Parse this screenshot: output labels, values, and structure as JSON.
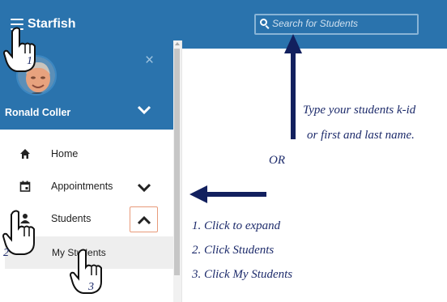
{
  "topbar": {
    "brand": "Starfish",
    "search_placeholder": "Search for Students"
  },
  "profile": {
    "name": "Ronald Coller",
    "close_glyph": "×"
  },
  "nav": {
    "items": [
      {
        "label": "Home",
        "icon": "home-icon"
      },
      {
        "label": "Appointments",
        "icon": "calendar-icon"
      },
      {
        "label": "Students",
        "icon": "students-icon"
      }
    ],
    "sub_items": [
      {
        "label": "My Students"
      }
    ]
  },
  "annotations": {
    "search_note_line1": "Type your students k-id",
    "search_note_line2": "or first and last name.",
    "or": "OR",
    "steps": [
      "1. Click to expand",
      "2. Click Students",
      "3. Click My Students"
    ],
    "hand_labels": [
      "1",
      "2",
      "3"
    ]
  },
  "colors": {
    "brand_blue": "#2a73ad",
    "annotation_navy": "#1d2b6b",
    "expand_border": "#e89a7a"
  }
}
